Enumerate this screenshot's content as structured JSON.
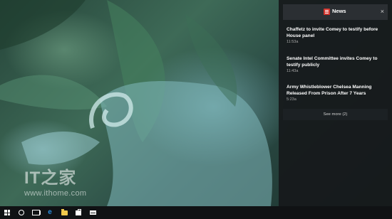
{
  "watermark": {
    "logo": "IT之家",
    "url": "www.ithome.com"
  },
  "action_center": {
    "app_name": "News",
    "close_label": "×",
    "notifications": [
      {
        "title": "Chaffetz to invite Comey to testify before House panel",
        "time": "11:53a"
      },
      {
        "title": "Senate Intel Committee invites Comey to testify publicly",
        "time": "11:43a"
      },
      {
        "title": "Army Whistleblower Chelsea Manning Released From Prison After 7 Years",
        "time": "5:23a"
      }
    ],
    "see_more": "See more (2)"
  },
  "taskbar": {
    "icons": [
      "windows-start-icon",
      "cortana-icon",
      "task-view-icon",
      "edge-icon",
      "file-explorer-icon",
      "store-icon",
      "mail-icon"
    ],
    "edge_glyph": "e"
  },
  "colors": {
    "panel_bg": "#161a1c",
    "header_bg": "#2b2f33",
    "news_red": "#d3342c",
    "edge_blue": "#2a8ee0",
    "folder_yellow": "#f2c94c",
    "taskbar_bg": "#101214"
  }
}
